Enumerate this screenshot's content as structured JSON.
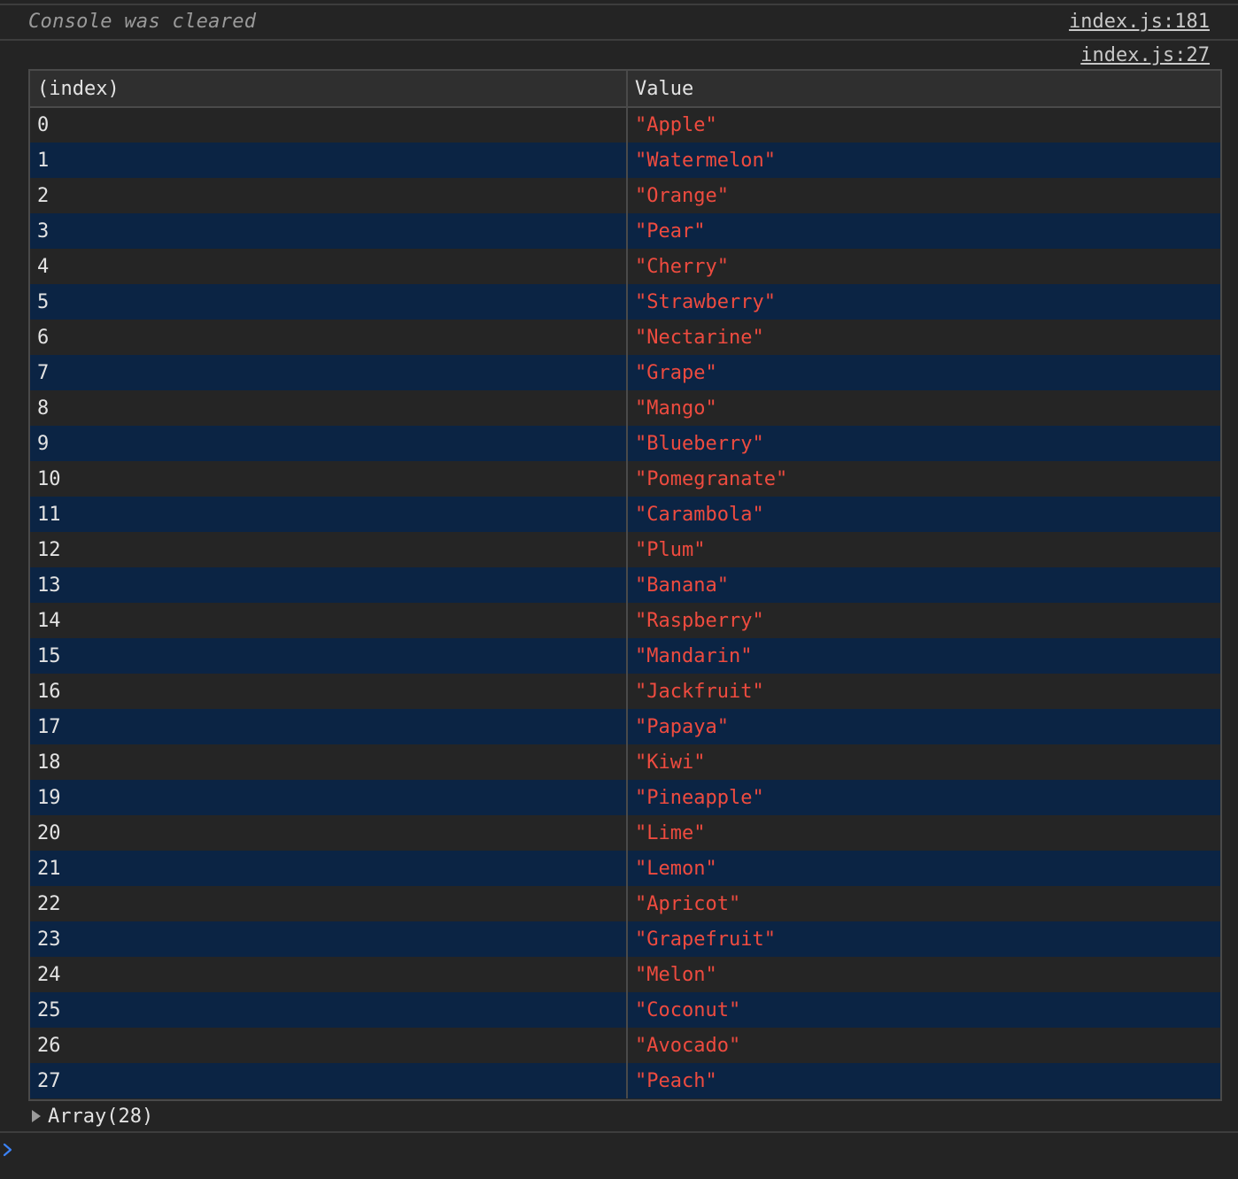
{
  "console": {
    "cleared_message": "Console was cleared",
    "cleared_source": "index.js:181",
    "table_source": "index.js:27"
  },
  "table": {
    "columns": [
      "(index)",
      "Value"
    ],
    "rows": [
      {
        "index": "0",
        "value": "\"Apple\""
      },
      {
        "index": "1",
        "value": "\"Watermelon\""
      },
      {
        "index": "2",
        "value": "\"Orange\""
      },
      {
        "index": "3",
        "value": "\"Pear\""
      },
      {
        "index": "4",
        "value": "\"Cherry\""
      },
      {
        "index": "5",
        "value": "\"Strawberry\""
      },
      {
        "index": "6",
        "value": "\"Nectarine\""
      },
      {
        "index": "7",
        "value": "\"Grape\""
      },
      {
        "index": "8",
        "value": "\"Mango\""
      },
      {
        "index": "9",
        "value": "\"Blueberry\""
      },
      {
        "index": "10",
        "value": "\"Pomegranate\""
      },
      {
        "index": "11",
        "value": "\"Carambola\""
      },
      {
        "index": "12",
        "value": "\"Plum\""
      },
      {
        "index": "13",
        "value": "\"Banana\""
      },
      {
        "index": "14",
        "value": "\"Raspberry\""
      },
      {
        "index": "15",
        "value": "\"Mandarin\""
      },
      {
        "index": "16",
        "value": "\"Jackfruit\""
      },
      {
        "index": "17",
        "value": "\"Papaya\""
      },
      {
        "index": "18",
        "value": "\"Kiwi\""
      },
      {
        "index": "19",
        "value": "\"Pineapple\""
      },
      {
        "index": "20",
        "value": "\"Lime\""
      },
      {
        "index": "21",
        "value": "\"Lemon\""
      },
      {
        "index": "22",
        "value": "\"Apricot\""
      },
      {
        "index": "23",
        "value": "\"Grapefruit\""
      },
      {
        "index": "24",
        "value": "\"Melon\""
      },
      {
        "index": "25",
        "value": "\"Coconut\""
      },
      {
        "index": "26",
        "value": "\"Avocado\""
      },
      {
        "index": "27",
        "value": "\"Peach\""
      }
    ]
  },
  "array_summary": {
    "label": "Array(28)",
    "icon": "expand-triangle-icon"
  },
  "prompt": {
    "icon": "console-prompt-chevron-icon"
  },
  "colors": {
    "background": "#242424",
    "row_alt": "#0b2444",
    "string_value": "#ee4b3f",
    "prompt_accent": "#3b82f6"
  }
}
